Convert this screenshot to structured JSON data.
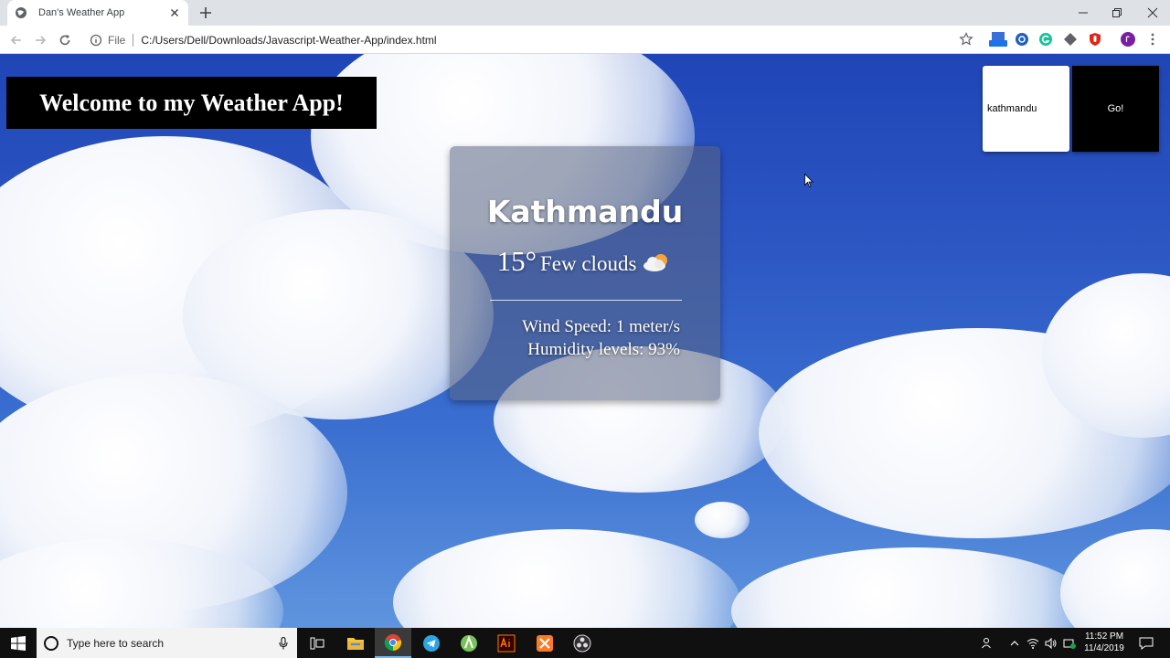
{
  "browser": {
    "tab_title": "Dan's Weather App",
    "scheme_label": "File",
    "url": "C:/Users/Dell/Downloads/Javascript-Weather-App/index.html"
  },
  "page": {
    "heading": "Welcome to my Weather App!",
    "search": {
      "value": "kathmandu",
      "placeholder": ""
    },
    "go_button_label": "Go!",
    "weather": {
      "city": "Kathmandu",
      "temperature": "15°",
      "description": "Few clouds",
      "icon": "partly-cloudy-icon",
      "wind_speed": "Wind Speed: 1 meter/s",
      "humidity": "Humidity levels: 93%"
    }
  },
  "taskbar": {
    "search_placeholder": "Type here to search",
    "time": "11:52 PM",
    "date": "11/4/2019"
  },
  "colors": {
    "heading_bg": "#000000",
    "sky": "#2d58c4",
    "card_bg": "rgba(90,100,130,0.55)"
  }
}
